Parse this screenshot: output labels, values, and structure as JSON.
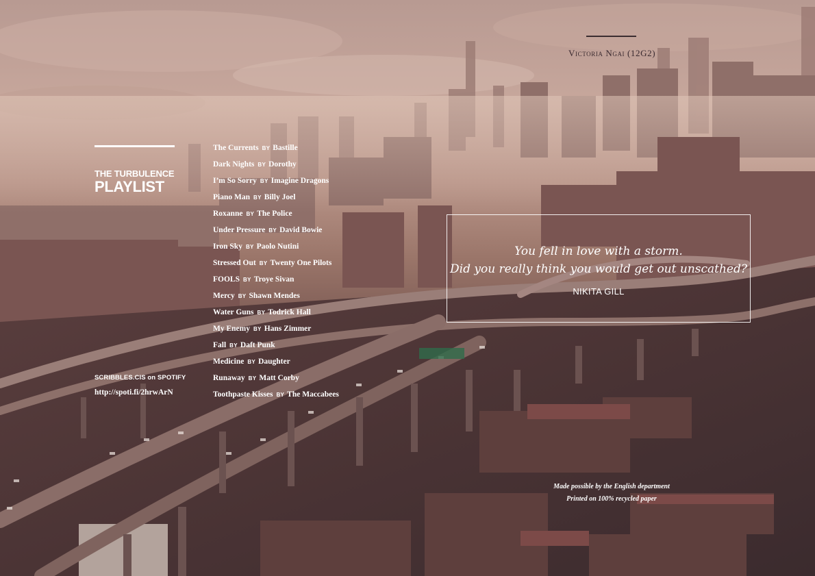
{
  "author": "Victoria Ngai (12G2)",
  "playlist": {
    "title_small": "THE TURBULENCE",
    "title_large": "PLAYLIST"
  },
  "spotify": {
    "handle": "SCRIBBLES.CIS on SPOTIFY",
    "url": "http://spoti.fi/2hrwArN"
  },
  "by_label": "BY",
  "tracks": [
    {
      "title": "The Currents",
      "artist": "Bastille"
    },
    {
      "title": "Dark Nights",
      "artist": "Dorothy"
    },
    {
      "title": "I’m So Sorry",
      "artist": "Imagine Dragons"
    },
    {
      "title": "Piano Man",
      "artist": "Billy Joel"
    },
    {
      "title": "Roxanne",
      "artist": "The Police"
    },
    {
      "title": "Under Pressure",
      "artist": "David Bowie"
    },
    {
      "title": "Iron Sky",
      "artist": "Paolo Nutini"
    },
    {
      "title": "Stressed Out",
      "artist": "Twenty One Pilots"
    },
    {
      "title": "FOOLS",
      "artist": "Troye Sivan"
    },
    {
      "title": "Mercy",
      "artist": "Shawn Mendes"
    },
    {
      "title": "Water Guns",
      "artist": "Todrick Hall"
    },
    {
      "title": "My Enemy",
      "artist": "Hans Zimmer"
    },
    {
      "title": "Fall",
      "artist": "Daft Punk"
    },
    {
      "title": "Medicine",
      "artist": "Daughter"
    },
    {
      "title": "Runaway",
      "artist": "Matt Corby"
    },
    {
      "title": "Toothpaste Kisses",
      "artist": "The Maccabees"
    }
  ],
  "quote": {
    "line1": "You fell in love with a storm.",
    "line2": "Did you really think you would get out unscathed?",
    "attribution": "NIKITA GILL"
  },
  "credits": {
    "line1": "Made possible by the English department",
    "line2": "Printed on 100% recycled paper"
  },
  "colors": {
    "sky": "#c9a89a",
    "haze": "#a98276",
    "city_dark": "#4f3436",
    "text": "#ffffff",
    "author_text": "#3a2a30"
  }
}
